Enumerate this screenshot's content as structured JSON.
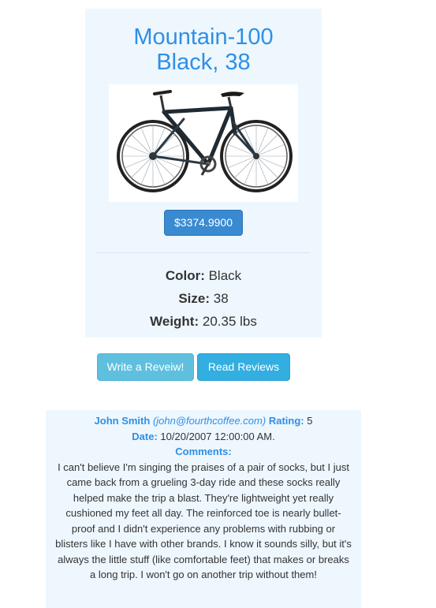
{
  "product": {
    "title_line1": "Mountain-100",
    "title_line2": "Black, 38",
    "price": "$3374.9900",
    "specs": {
      "color_label": "Color:",
      "color_value": "Black",
      "size_label": "Size:",
      "size_value": "38",
      "weight_label": "Weight:",
      "weight_value": "20.35 lbs"
    }
  },
  "actions": {
    "write_review": "Write a Reveiw!",
    "read_reviews": "Read Reviews"
  },
  "review": {
    "name": "John Smith",
    "email": "(john@fourthcoffee.com)",
    "rating_label": "Rating:",
    "rating_value": "5",
    "date_label": "Date:",
    "date_value": "10/20/2007 12:00:00 AM.",
    "comments_label": "Comments:",
    "comments": "I can't believe I'm singing the praises of a pair of socks, but I just came back from a grueling 3-day ride and these socks really helped make the trip a blast. They're lightweight yet really cushioned my feet all day. The reinforced toe is nearly bullet-proof and I didn't experience any problems with rubbing or blisters like I have with other brands. I know it sounds silly, but it's always the little stuff (like comfortable feet) that makes or breaks a long trip. I won't go on another trip without them!"
  },
  "colors": {
    "title_blue": "#2e8fe6",
    "card_background": "#eef7fe",
    "price_button": "#3a8ad2",
    "write_button": "#5ec0de",
    "read_button": "#32aee0"
  }
}
